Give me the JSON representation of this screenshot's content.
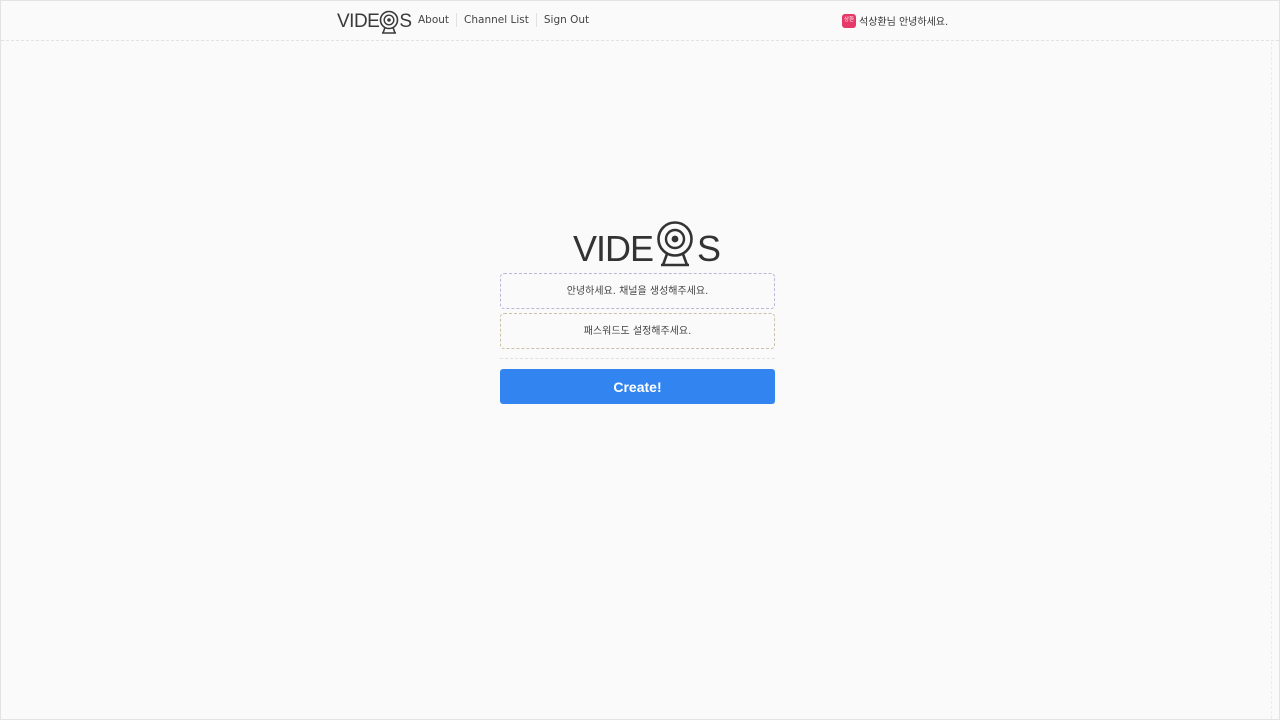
{
  "header": {
    "logo_text": "VIDE",
    "logo_text_end": "S",
    "nav": [
      {
        "label": "About"
      },
      {
        "label": "Channel List"
      },
      {
        "label": "Sign Out"
      }
    ],
    "user": {
      "avatar_text": "상환",
      "avatar_color": "#e53967",
      "greeting": "석상환님 안녕하세요."
    }
  },
  "form": {
    "logo_text": "VIDE",
    "logo_text_end": "S",
    "channel_placeholder": "안녕하세요. 채널을 생성해주세요.",
    "password_placeholder": "패스워드도 설정해주세요.",
    "submit_label": "Create!",
    "submit_color": "#3285f0"
  },
  "icons": {
    "logo_camera": "webcam-icon"
  }
}
